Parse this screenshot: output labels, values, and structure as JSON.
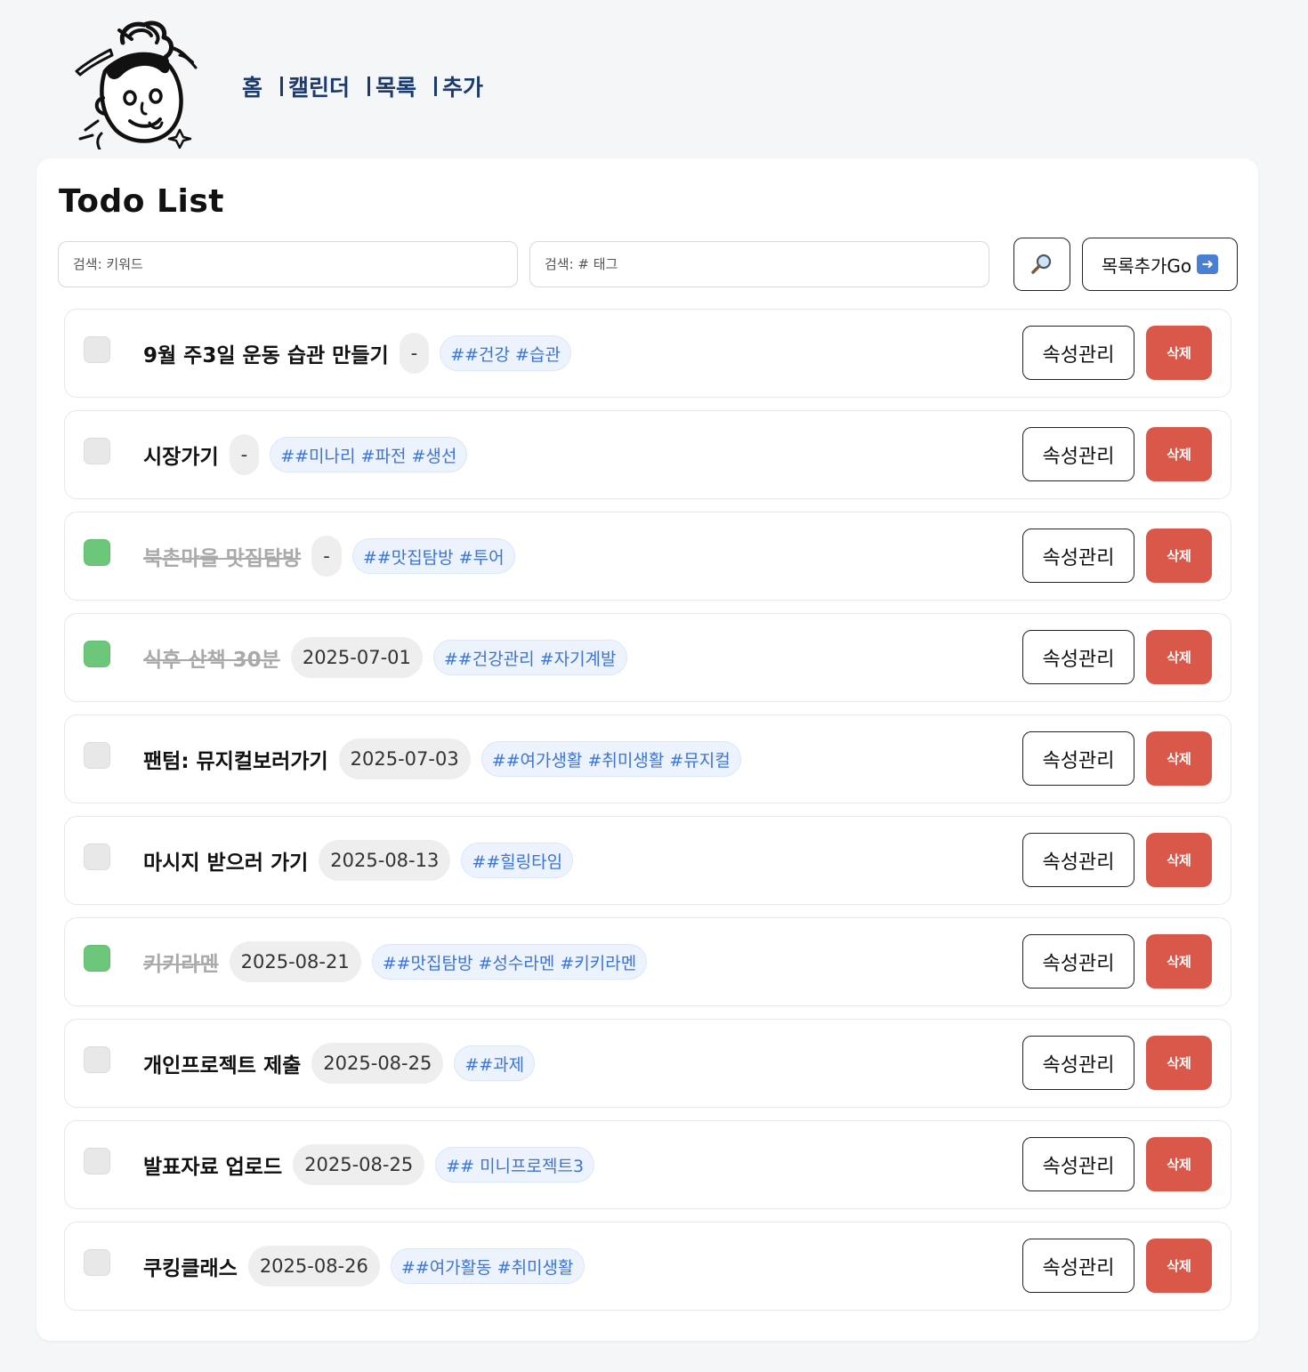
{
  "nav": {
    "items": [
      {
        "label": "홈"
      },
      {
        "label": "캘린더"
      },
      {
        "label": "목록"
      },
      {
        "label": "추가"
      }
    ]
  },
  "main": {
    "title": "Todo List",
    "search": {
      "keyword_placeholder": "검색: 키워드",
      "tag_placeholder": "검색: # 태그",
      "search_icon": "magnifier-icon",
      "add_button_label": "목록추가Go",
      "add_button_icon": "right-arrow-icon"
    },
    "colors": {
      "nav_text": "#1d3a6e",
      "checked": "#6cc77b",
      "delete": "#d9584a",
      "tag_text": "#3d74d6",
      "tag_bg": "#edf3fd"
    },
    "todos": [
      {
        "title": "9월 주3일 운동 습관 만들기",
        "date": "-",
        "tags": "##건강 #습관",
        "done": false
      },
      {
        "title": "시장가기",
        "date": "-",
        "tags": "##미나리 #파전 #생선",
        "done": false
      },
      {
        "title": "북촌마을 맛집탐방",
        "date": "-",
        "tags": "##맛집탐방 #투어",
        "done": true
      },
      {
        "title": "식후 산책 30분",
        "date": "2025-07-01",
        "tags": "##건강관리 #자기계발",
        "done": true
      },
      {
        "title": "팬텀: 뮤지컬보러가기",
        "date": "2025-07-03",
        "tags": "##여가생활 #취미생활 #뮤지컬",
        "done": false
      },
      {
        "title": "마시지 받으러 가기",
        "date": "2025-08-13",
        "tags": "##힐링타임",
        "done": false
      },
      {
        "title": "키키라멘",
        "date": "2025-08-21",
        "tags": "##맛집탐방 #성수라멘 #키키라멘",
        "done": true
      },
      {
        "title": "개인프로젝트 제출",
        "date": "2025-08-25",
        "tags": "##과제",
        "done": false
      },
      {
        "title": "발표자료 업로드",
        "date": "2025-08-25",
        "tags": "## 미니프로젝트3",
        "done": false
      },
      {
        "title": "쿠킹클래스",
        "date": "2025-08-26",
        "tags": "##여가활동 #취미생활",
        "done": false
      }
    ],
    "attr_button_label": "속성관리",
    "delete_button_label": "삭제"
  }
}
